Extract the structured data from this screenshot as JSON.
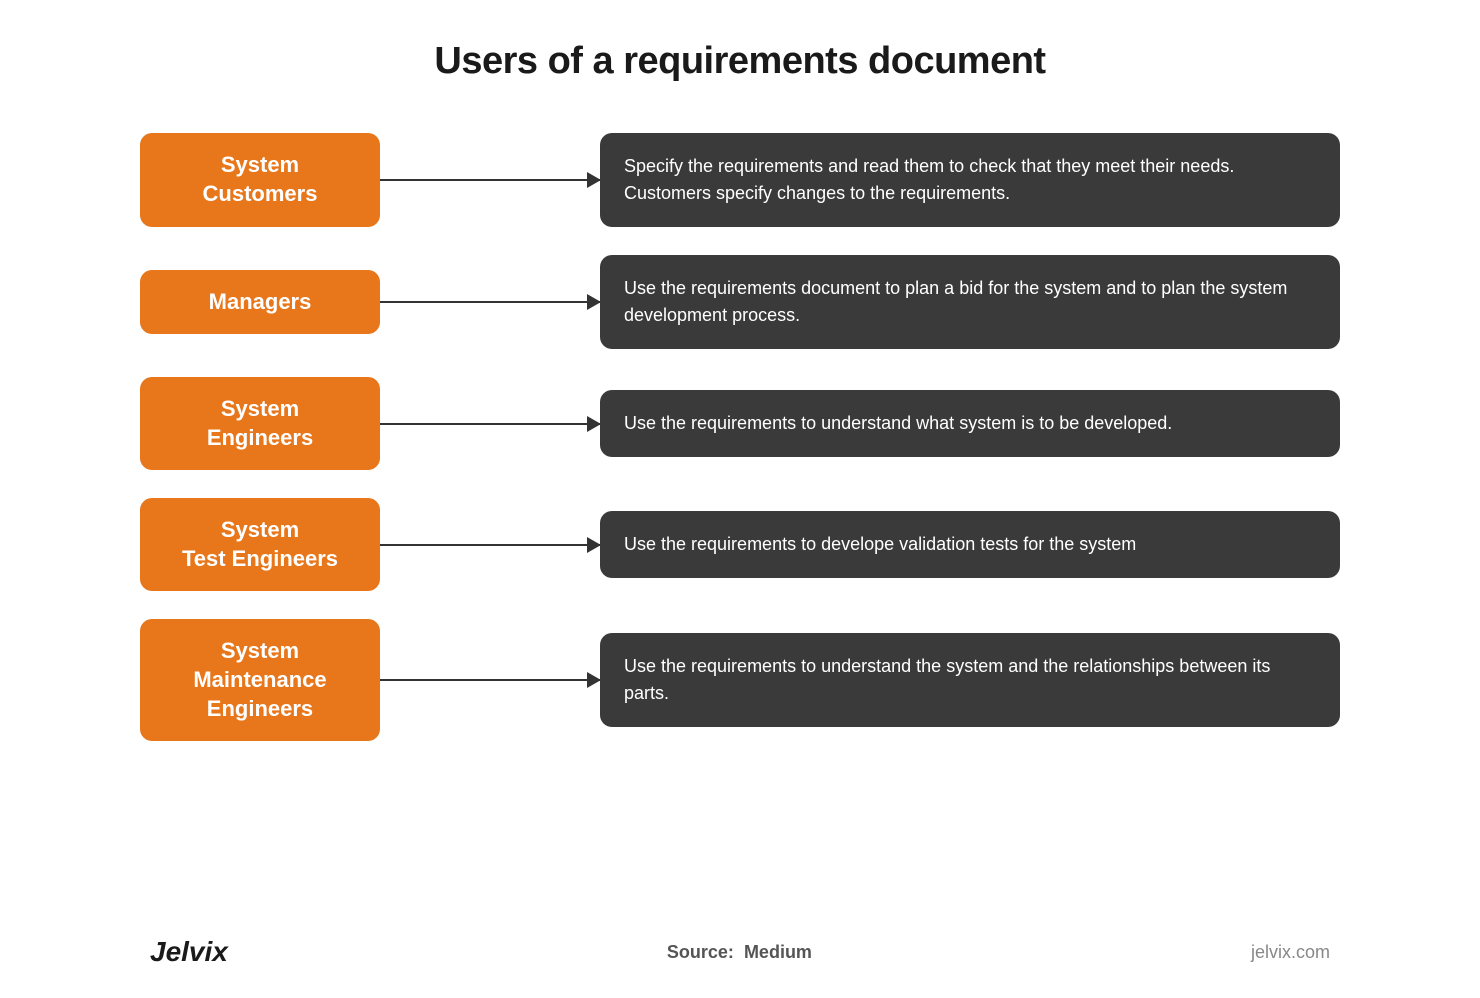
{
  "page": {
    "title": "Users of a requirements document",
    "background_color": "#ffffff"
  },
  "rows": [
    {
      "id": "row-1",
      "label": "System\nCustomers",
      "description": "Specify the requirements and read them to check that they meet their needs. Customers specify changes to the requirements."
    },
    {
      "id": "row-2",
      "label": "Managers",
      "description": "Use the requirements document to plan a bid for the system and to plan the system development process."
    },
    {
      "id": "row-3",
      "label": "System\nEngineers",
      "description": "Use the requirements to understand what system is to be developed."
    },
    {
      "id": "row-4",
      "label": "System\nTest Engineers",
      "description": "Use the requirements to develope validation tests for the system"
    },
    {
      "id": "row-5",
      "label": "System\nMaintenance\nEngineers",
      "description": "Use the requirements to understand the system and the relationships between its parts."
    }
  ],
  "footer": {
    "brand": "Jelvix",
    "source_label": "Source:",
    "source_value": "Medium",
    "url": "jelvix.com"
  },
  "colors": {
    "orange": "#E8761A",
    "dark_box": "#3a3a3a",
    "arrow": "#333333",
    "title": "#1a1a1a"
  }
}
